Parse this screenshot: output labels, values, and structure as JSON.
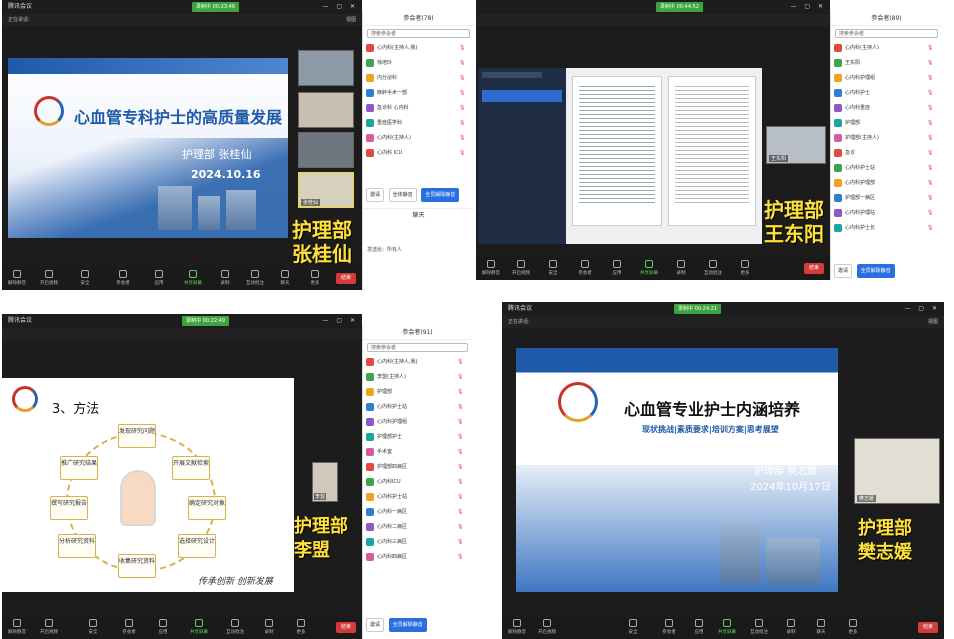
{
  "q1": {
    "window_title": "腾讯会议",
    "recording": "录制中 00:23:46",
    "speaker_bar": "正在讲话：",
    "view": "视图",
    "slide_title": "心血管专科护士的高质量发展",
    "presenter": "护理部 张桂仙",
    "date": "2024.10.16",
    "caption_dept": "护理部",
    "caption_name": "张桂仙",
    "thumb_label": "张桂仙",
    "panel_title": "参会者(78)",
    "search": "搜索参会者",
    "participants": [
      "心内科(主持人,我)",
      "徐培玲",
      "内分泌科",
      "麻醉手术一部",
      "急诊科 心内科",
      "重症医学科",
      "心内科(主持人)",
      "心内科 ICU"
    ],
    "footer_btns": [
      "邀请",
      "全体静音",
      "全员解除静音"
    ],
    "footer2": "聊天",
    "chat_hint": "发送给：所有人",
    "toolbar": [
      "解除静音",
      "开启视频",
      "安全",
      "参会者",
      "应用",
      "共享屏幕",
      "录制",
      "互动批注",
      "聊天",
      "更多"
    ],
    "end": "结束"
  },
  "q2": {
    "recording": "录制中 00:44:52",
    "caption_dept": "护理部",
    "caption_name": "王东阳",
    "thumb_label": "王东阳",
    "panel_title": "参会者(89)",
    "search": "搜索参会者",
    "participants": [
      "心内科(主持人)",
      "王东阳",
      "心内科护理组",
      "心内科护士",
      "心内科重症",
      "护理部",
      "护理部(主持人)",
      "急诊",
      "心内科护士站",
      "心内科护理部",
      "护理部一病区",
      "心内科护理站",
      "心内科护士长"
    ],
    "end": "结束"
  },
  "q3": {
    "recording": "录制中 00:22:49",
    "slide_heading": "3、方法",
    "cycle": [
      "发现研究问题",
      "开展文献检索",
      "确定研究对象",
      "选择研究设计",
      "收集研究资料",
      "分析研究资料",
      "撰写研究报告",
      "推广研究结果"
    ],
    "slogan": "传承创新 创新发展",
    "caption_dept": "护理部",
    "caption_name": "李盟",
    "thumb_label": "李盟",
    "panel_title": "参会者(91)",
    "search": "搜索参会者",
    "participants": [
      "心内科(主持人,我)",
      "李盟(主持人)",
      "护理部",
      "心内科护士站",
      "心内科护理组",
      "护理部护士",
      "手术室",
      "护理部四病区",
      "心内科ICU",
      "心内科护士站",
      "心内科一病区",
      "心内科二病区",
      "心内科三病区",
      "心内科四病区"
    ],
    "end": "结束"
  },
  "q4": {
    "recording": "录制中 00:24:21",
    "speaker_bar": "正在讲话：",
    "slide_title": "心血管专业护士内涵培养",
    "subtitle": "现状挑战|素质要求|培训方案|思考展望",
    "presenter": "护理部 樊志媛",
    "date": "2024年10月17日",
    "caption_dept": "护理部",
    "caption_name": "樊志媛",
    "thumb_label": "樊志媛",
    "end": "结束"
  },
  "colors": {
    "slide_blue": "#1f5aa8",
    "caption_yellow": "#ffe13a",
    "rec_green": "#3fa33f",
    "end_red": "#d63b3b"
  }
}
